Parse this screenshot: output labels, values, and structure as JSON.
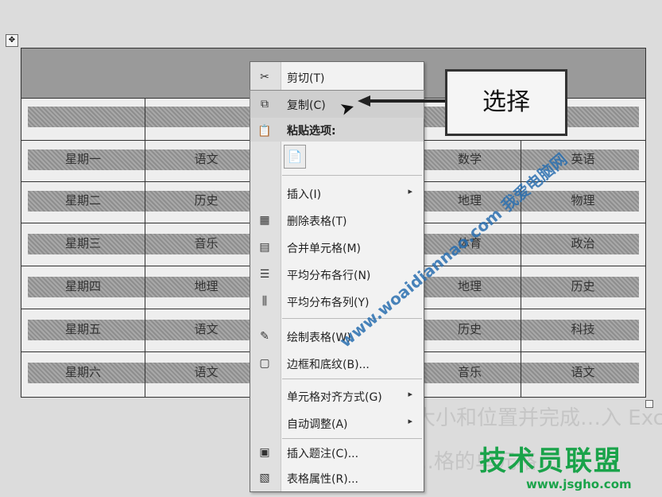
{
  "background_text": [
    "…的大小和位置并完成…入 Excel 表格操作",
    "…格的单元格…"
  ],
  "table": {
    "rows": [
      [
        "星期一",
        "语文",
        "数学",
        "英语"
      ],
      [
        "星期二",
        "历史",
        "地理",
        "物理"
      ],
      [
        "星期三",
        "音乐",
        "体育",
        "政治"
      ],
      [
        "星期四",
        "地理",
        "地理",
        "历史"
      ],
      [
        "星期五",
        "语文",
        "历史",
        "科技"
      ],
      [
        "星期六",
        "语文",
        "音乐",
        "语文"
      ]
    ]
  },
  "context_menu": {
    "items": [
      {
        "label": "剪切(T)",
        "icon": "scissors-icon",
        "glyph": "✂"
      },
      {
        "label": "复制(C)",
        "icon": "copy-icon",
        "glyph": "⧉"
      },
      {
        "label": "粘贴选项:",
        "icon": "paste-options-icon",
        "glyph": "📋"
      },
      {
        "label": "插入(I)",
        "icon": "",
        "glyph": "",
        "submenu": true
      },
      {
        "label": "删除表格(T)",
        "icon": "delete-table-icon",
        "glyph": "▦"
      },
      {
        "label": "合并单元格(M)",
        "icon": "merge-cells-icon",
        "glyph": "▤"
      },
      {
        "label": "平均分布各行(N)",
        "icon": "distribute-rows-icon",
        "glyph": "☰"
      },
      {
        "label": "平均分布各列(Y)",
        "icon": "distribute-columns-icon",
        "glyph": "⫼"
      },
      {
        "label": "绘制表格(W)",
        "icon": "draw-table-icon",
        "glyph": "✎"
      },
      {
        "label": "边框和底纹(B)...",
        "icon": "borders-icon",
        "glyph": "▢"
      },
      {
        "label": "单元格对齐方式(G)",
        "icon": "",
        "glyph": "",
        "submenu": true
      },
      {
        "label": "自动调整(A)",
        "icon": "",
        "glyph": "",
        "submenu": true
      },
      {
        "label": "插入题注(C)...",
        "icon": "insert-caption-icon",
        "glyph": "▣"
      },
      {
        "label": "表格属性(R)...",
        "icon": "table-properties-icon",
        "glyph": "▧"
      }
    ],
    "paste_button_glyph": "📄",
    "submenu_arrow": "▸"
  },
  "callout": {
    "label": "选择"
  },
  "watermark": "www.woaidiannao.com 我爱电脑网",
  "logo": {
    "cn": "技术员联盟",
    "url": "www.jsgho.com"
  },
  "colors": {
    "logo_green": "#1aa34a",
    "watermark_blue": "#2a6fb0"
  }
}
